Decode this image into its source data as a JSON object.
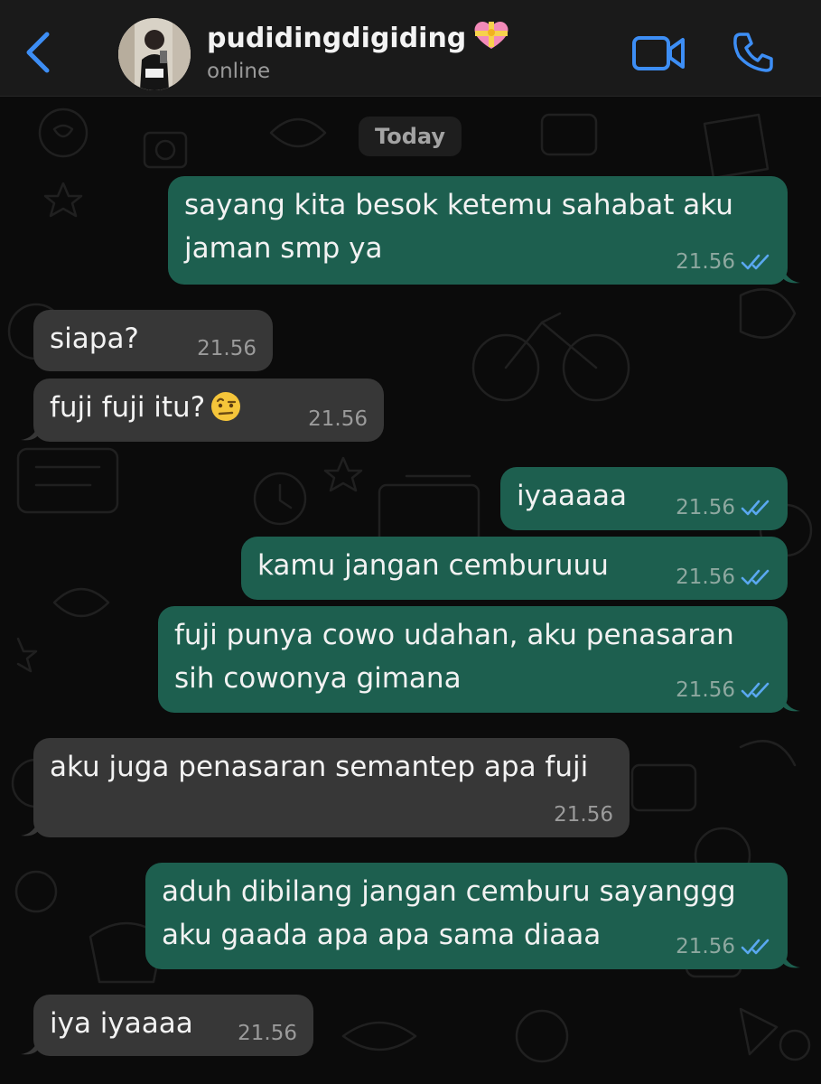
{
  "header": {
    "contact_name": "pudidingdigiding",
    "status": "online",
    "icons": {
      "back": "chevron-left-icon",
      "video": "video-camera-icon",
      "call": "phone-icon",
      "name_badge": "heart-with-ribbon-icon"
    }
  },
  "chat": {
    "date_label": "Today",
    "messages": [
      {
        "dir": "out",
        "text": "sayang kita besok ketemu sahabat aku\njaman smp ya",
        "time": "21.56",
        "read": true
      },
      {
        "dir": "in",
        "text": "siapa?",
        "time": "21.56"
      },
      {
        "dir": "in",
        "text": "fuji fuji itu?",
        "time": "21.56",
        "emoji": "face-with-raised-eyebrow"
      },
      {
        "dir": "out",
        "text": "iyaaaaa",
        "time": "21.56",
        "read": true
      },
      {
        "dir": "out",
        "text": "kamu jangan cemburuuu",
        "time": "21.56",
        "read": true
      },
      {
        "dir": "out",
        "text": "fuji punya cowo udahan, aku penasaran\nsih cowonya gimana",
        "time": "21.56",
        "read": true
      },
      {
        "dir": "in",
        "text": "aku juga penasaran semantep apa fuji",
        "time": "21.56"
      },
      {
        "dir": "out",
        "text": "aduh dibilang jangan cemburu sayanggg\naku gaada apa apa sama diaaa",
        "time": "21.56",
        "read": true
      },
      {
        "dir": "in",
        "text": "iya iyaaaa",
        "time": "21.56"
      }
    ]
  },
  "colors": {
    "accent": "#3d8ef5",
    "outgoing_bubble": "#1d5f4f",
    "incoming_bubble": "#373737",
    "read_ticks": "#5aa8f0"
  }
}
